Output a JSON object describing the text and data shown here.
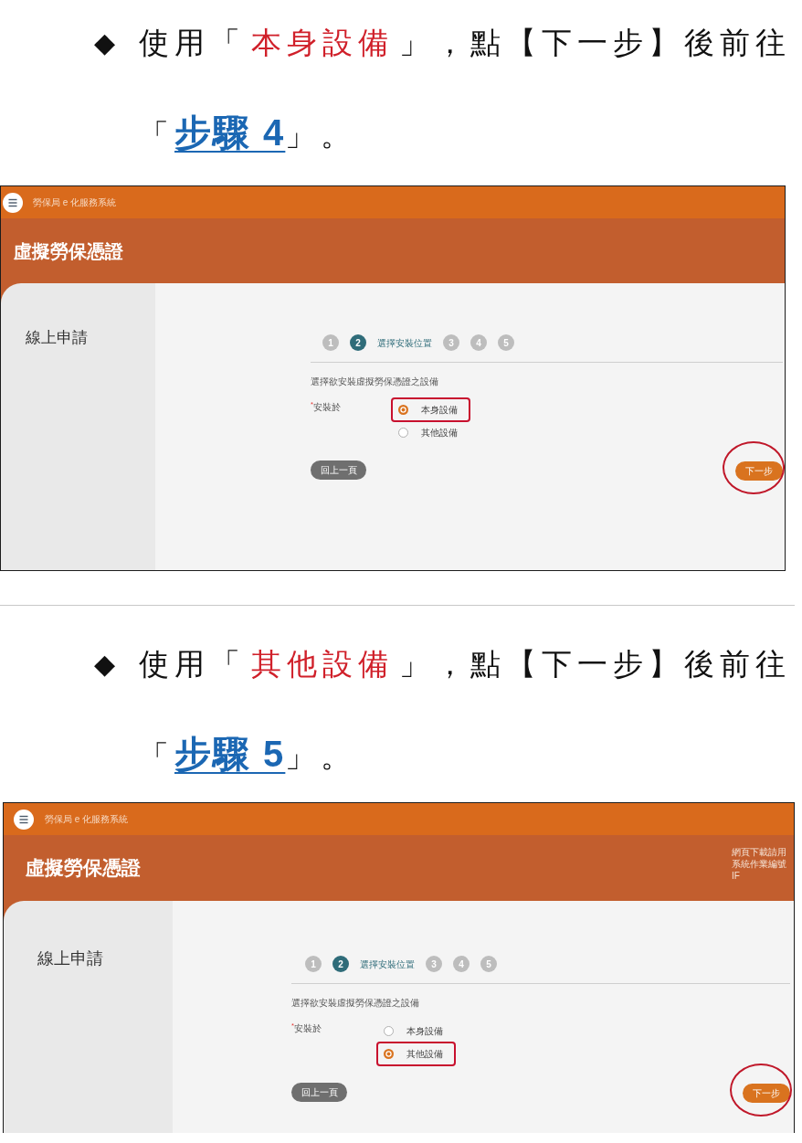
{
  "sections": [
    {
      "instruction": {
        "bullet": "◆",
        "lines": [
          [
            {
              "kind": "plain",
              "text": "使用「"
            },
            {
              "kind": "highlight",
              "text": "本身設備"
            },
            {
              "kind": "plain",
              "text": "」，點【下一步】後前往"
            }
          ],
          [
            {
              "kind": "plain",
              "text": "「"
            },
            {
              "kind": "link",
              "text": "步驟 4"
            },
            {
              "kind": "plain",
              "text": "」。"
            }
          ]
        ]
      },
      "screenshot": {
        "top_bar": {
          "system_name": "勞保局 e 化服務系統"
        },
        "title": "虛擬勞保憑證",
        "sidebar": {
          "items": [
            "線上申請"
          ]
        },
        "stepper": [
          {
            "number": "1",
            "selected": false
          },
          {
            "number": "2",
            "selected": true,
            "label": "選擇安裝位置"
          },
          {
            "number": "3",
            "selected": false
          },
          {
            "number": "4",
            "selected": false
          },
          {
            "number": "5",
            "selected": false
          }
        ],
        "description": "選擇欲安裝虛擬勞保憑證之設備",
        "field": {
          "label": "$^{*}$安裝於",
          "options": [
            {
              "label": "本身設備",
              "selected": true,
              "marked": true
            },
            {
              "label": "其他設備",
              "selected": false,
              "marked": false
            }
          ]
        },
        "back_button": {
          "label": "回上一頁"
        },
        "next_button": {
          "label": "下一步",
          "circled": true
        }
      }
    },
    {
      "instruction": {
        "bullet": "◆",
        "lines": [
          [
            {
              "kind": "plain",
              "text": "使用「"
            },
            {
              "kind": "highlight",
              "text": "其他設備"
            },
            {
              "kind": "plain",
              "text": "」，點【下一步】後前往"
            }
          ],
          [
            {
              "kind": "plain",
              "text": "「"
            },
            {
              "kind": "link",
              "text": "步驟 5"
            },
            {
              "kind": "plain",
              "text": "」。"
            }
          ]
        ]
      },
      "screenshot": {
        "top_bar": {
          "system_name": "勞保局 e 化服務系統"
        },
        "title": "虛擬勞保憑證",
        "notice": "網頁下載請用系統作業編號IF",
        "sidebar": {
          "items": [
            "線上申請"
          ]
        },
        "stepper": [
          {
            "number": "1",
            "selected": false
          },
          {
            "number": "2",
            "selected": true,
            "label": "選擇安裝位置"
          },
          {
            "number": "3",
            "selected": false
          },
          {
            "number": "4",
            "selected": false
          },
          {
            "number": "5",
            "selected": false
          }
        ],
        "description": "選擇欲安裝虛擬勞保憑證之設備",
        "field": {
          "label": "$^{*}$安裝於",
          "options": [
            {
              "label": "本身設備",
              "selected": false,
              "marked": false
            },
            {
              "label": "其他設備",
              "selected": true,
              "marked": true
            }
          ]
        },
        "back_button": {
          "label": "回上一頁"
        },
        "next_button": {
          "label": "下一步",
          "circled": true
        }
      }
    }
  ]
}
